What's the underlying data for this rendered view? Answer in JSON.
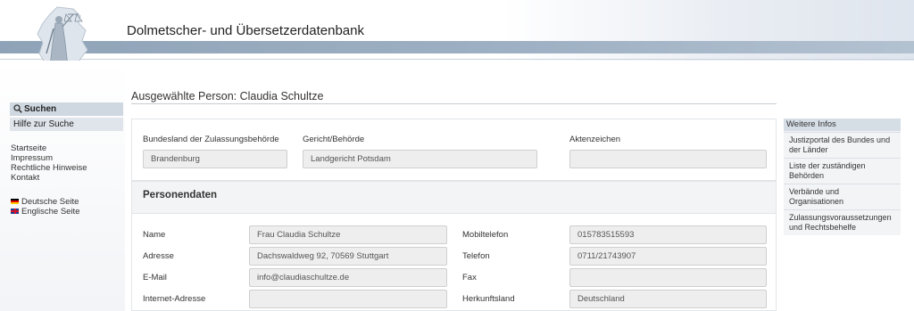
{
  "header": {
    "app_title": "Dolmetscher- und Übersetzerdatenbank"
  },
  "sidebar": {
    "search_label": "Suchen",
    "help_label": "Hilfe zur Suche",
    "links": [
      "Startseite",
      "Impressum",
      "Rechtliche Hinweise",
      "Kontakt"
    ],
    "languages": [
      "Deutsche Seite",
      "Englische Seite"
    ]
  },
  "page": {
    "heading": "Ausgewählte Person: Claudia Schultze"
  },
  "authority": {
    "state_label": "Bundesland der Zulassungsbehörde",
    "state_value": "Brandenburg",
    "court_label": "Gericht/Behörde",
    "court_value": "Landgericht Potsdam",
    "file_label": "Aktenzeichen",
    "file_value": ""
  },
  "personal": {
    "section_title": "Personendaten",
    "name_label": "Name",
    "name_value": "Frau Claudia Schultze",
    "address_label": "Adresse",
    "address_value": "Dachswaldweg 92, 70569 Stuttgart",
    "email_label": "E-Mail",
    "email_value": "info@claudiaschultze.de",
    "web_label": "Internet-Adresse",
    "web_value": "",
    "mobile_label": "Mobiltelefon",
    "mobile_value": "015783515593",
    "phone_label": "Telefon",
    "phone_value": "0711/21743907",
    "fax_label": "Fax",
    "fax_value": "",
    "origin_label": "Herkunftsland",
    "origin_value": "Deutschland"
  },
  "more_info": {
    "title": "Weitere Infos",
    "links": [
      "Justizportal des Bundes und der Länder",
      "Liste der zuständigen Behörden",
      "Verbände und Organisationen",
      "Zulassungsvoraussetzungen und Rechtsbehelfe"
    ]
  },
  "icons": {
    "search": "search-icon",
    "logo": "justitia-logo",
    "flag_de": "flag-de-icon",
    "flag_gb": "flag-gb-icon"
  }
}
